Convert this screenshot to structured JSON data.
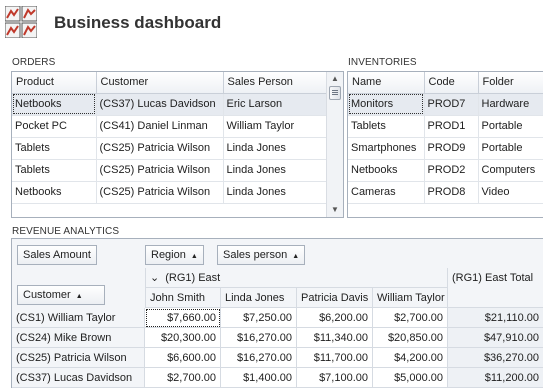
{
  "header": {
    "title": "Business dashboard",
    "icon": "chart-grid-icon"
  },
  "orders": {
    "label": "ORDERS",
    "columns": [
      "Product",
      "Customer",
      "Sales Person"
    ],
    "rows": [
      [
        "Netbooks",
        "(CS37) Lucas Davidson",
        "Eric Larson"
      ],
      [
        "Pocket PC",
        "(CS41) Daniel Linman",
        "William Taylor"
      ],
      [
        "Tablets",
        "(CS25) Patricia Wilson",
        "Linda Jones"
      ],
      [
        "Tablets",
        "(CS25) Patricia Wilson",
        "Linda Jones"
      ],
      [
        "Netbooks",
        "(CS25) Patricia Wilson",
        "Linda Jones"
      ]
    ],
    "selected_row": 0
  },
  "inventories": {
    "label": "INVENTORIES",
    "columns": [
      "Name",
      "Code",
      "Folder"
    ],
    "rows": [
      [
        "Monitors",
        "PROD7",
        "Hardware"
      ],
      [
        "Tablets",
        "PROD1",
        "Portable"
      ],
      [
        "Smartphones",
        "PROD9",
        "Portable"
      ],
      [
        "Netbooks",
        "PROD2",
        "Computers"
      ],
      [
        "Cameras",
        "PROD8",
        "Video"
      ]
    ],
    "selected_row": 0
  },
  "revenue": {
    "label": "REVENUE ANALYTICS",
    "data_field": "Sales Amount",
    "column_fields": [
      "Region",
      "Sales person"
    ],
    "row_field": "Customer",
    "group": {
      "expander": "⌄",
      "label": "(RG1) East",
      "total_label": "(RG1) East Total"
    },
    "columns": [
      "John Smith",
      "Linda Jones",
      "Patricia Davis",
      "William Taylor"
    ],
    "rows": [
      {
        "label": "(CS1) William Taylor",
        "values": [
          "$7,660.00",
          "$7,250.00",
          "$6,200.00",
          "$2,700.00"
        ],
        "total": "$21,110.00"
      },
      {
        "label": "(CS24) Mike Brown",
        "values": [
          "$20,300.00",
          "$16,270.00",
          "$11,340.00",
          "$20,850.00"
        ],
        "total": "$47,910.00"
      },
      {
        "label": "(CS25) Patricia Wilson",
        "values": [
          "$6,600.00",
          "$16,270.00",
          "$11,700.00",
          "$4,200.00"
        ],
        "total": "$36,270.00"
      },
      {
        "label": "(CS37) Lucas Davidson",
        "values": [
          "$2,700.00",
          "$1,400.00",
          "$7,100.00",
          "$5,000.00"
        ],
        "total": "$11,200.00"
      }
    ]
  }
}
